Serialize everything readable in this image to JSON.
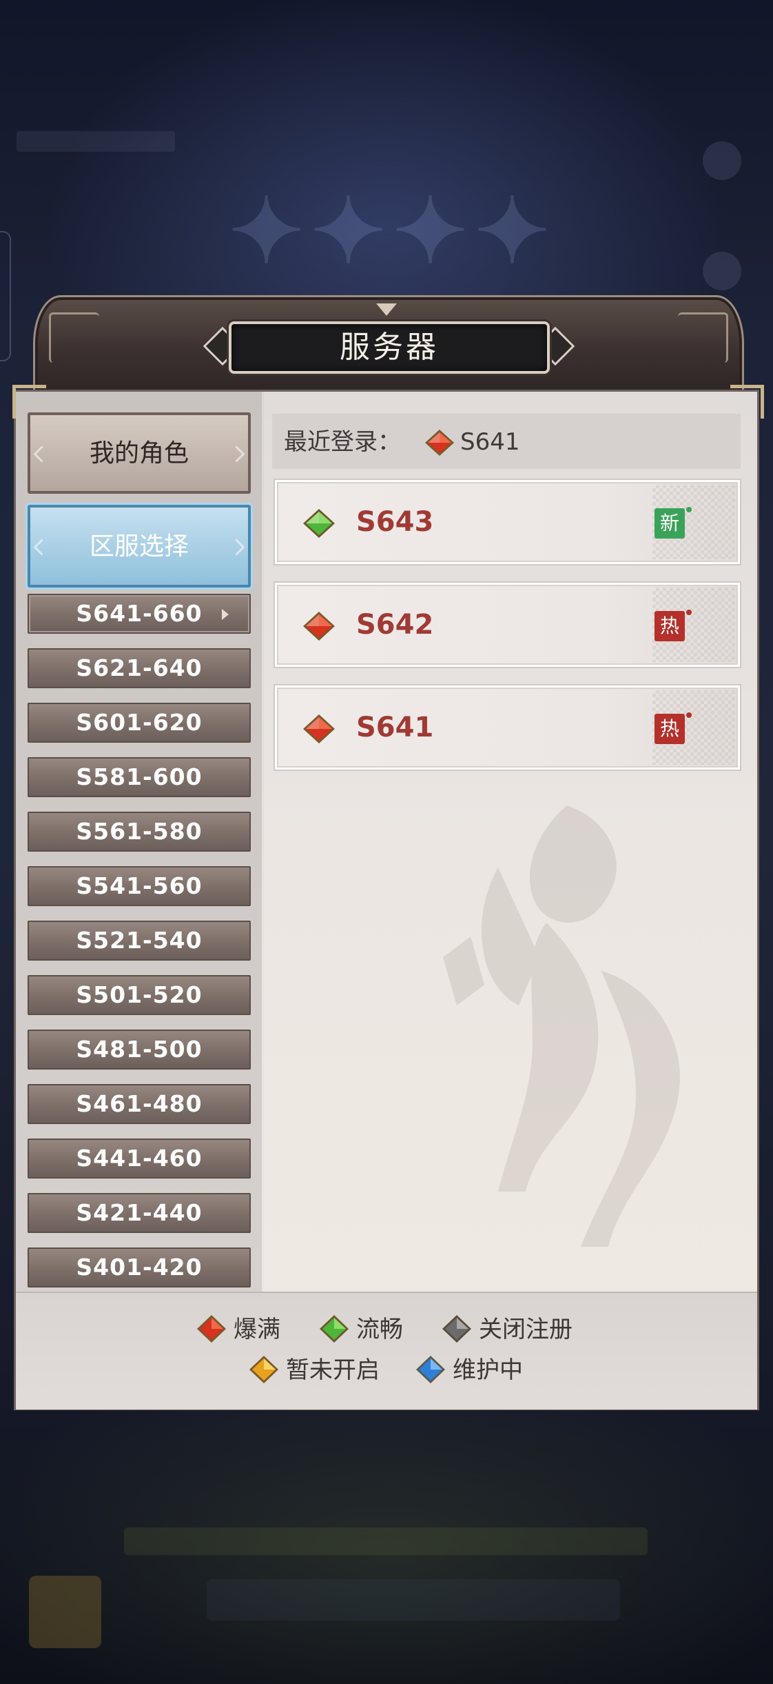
{
  "dialog": {
    "title": "服务器"
  },
  "tabs": [
    {
      "label": "我的角色"
    },
    {
      "label": "区服选择"
    }
  ],
  "server_ranges": [
    {
      "label": "S641-660",
      "selected": true
    },
    {
      "label": "S621-640"
    },
    {
      "label": "S601-620"
    },
    {
      "label": "S581-600"
    },
    {
      "label": "S561-580"
    },
    {
      "label": "S541-560"
    },
    {
      "label": "S521-540"
    },
    {
      "label": "S501-520"
    },
    {
      "label": "S481-500"
    },
    {
      "label": "S461-480"
    },
    {
      "label": "S441-460"
    },
    {
      "label": "S421-440"
    },
    {
      "label": "S401-420"
    }
  ],
  "recent_login": {
    "label": "最近登录：",
    "server": "S641",
    "status": "爆满"
  },
  "servers": [
    {
      "name": "S643",
      "status": "流畅",
      "badge": "新"
    },
    {
      "name": "S642",
      "status": "爆满",
      "badge": "热"
    },
    {
      "name": "S641",
      "status": "爆满",
      "badge": "热"
    }
  ],
  "legend": [
    {
      "label": "爆满",
      "color": "#d6321f"
    },
    {
      "label": "流畅",
      "color": "#4fb43a"
    },
    {
      "label": "关闭注册",
      "color": "#6b6b6b"
    },
    {
      "label": "暂未开启",
      "color": "#e8a21d"
    },
    {
      "label": "维护中",
      "color": "#2f7fd8"
    }
  ]
}
